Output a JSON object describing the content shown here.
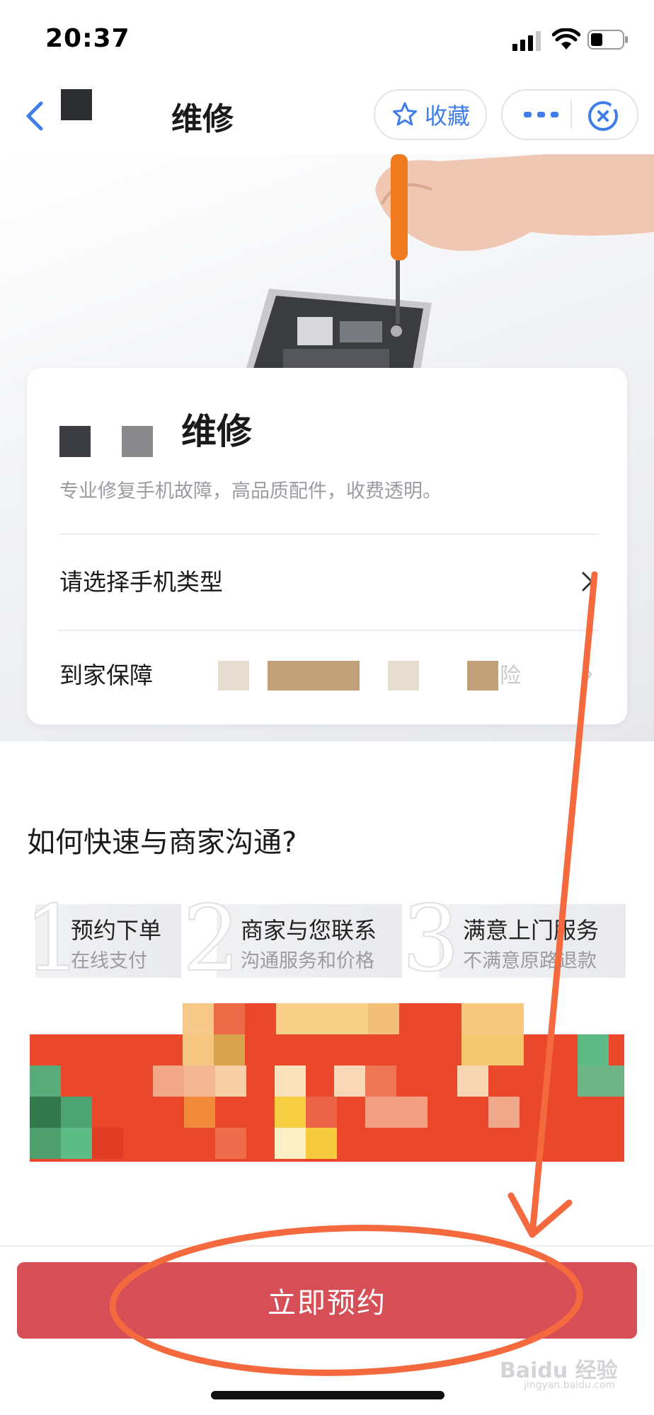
{
  "status_bar": {
    "time": "20:37"
  },
  "nav": {
    "title": "维修",
    "favorite_label": "收藏"
  },
  "card": {
    "title": "维修",
    "subtitle": "专业修复手机故障，高品质配件，收费透明。",
    "phone_type_label": "请选择手机类型",
    "guarantee_label": "到家保障",
    "guarantee_tail": "险"
  },
  "how": {
    "heading": "如何快速与商家沟通?",
    "steps": [
      {
        "num": "1",
        "title": "预约下单",
        "sub": "在线支付"
      },
      {
        "num": "2",
        "title": "商家与您联系",
        "sub": "沟通服务和价格"
      },
      {
        "num": "3",
        "title": "满意上门服务",
        "sub": "不满意原路退款"
      }
    ]
  },
  "bottom": {
    "book_label": "立即预约"
  },
  "watermark": {
    "text": "Baidu 经验",
    "url": "jingyan.baidu.com"
  },
  "colors": {
    "accent_blue": "#3f7ee8",
    "book_button": "#d64f56",
    "annotation_orange": "#f46a3e"
  }
}
